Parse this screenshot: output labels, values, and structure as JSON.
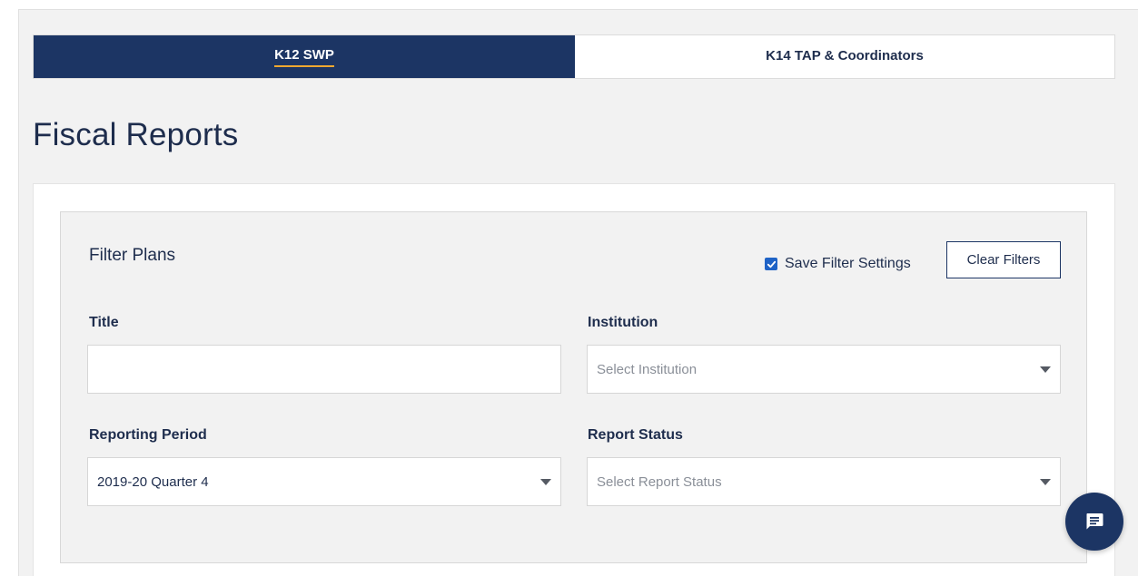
{
  "tabs": [
    {
      "label": "K12 SWP",
      "active": true
    },
    {
      "label": "K14 TAP & Coordinators",
      "active": false
    }
  ],
  "page_title": "Fiscal Reports",
  "filters": {
    "title": "Filter Plans",
    "save_settings_label": "Save Filter Settings",
    "save_settings_checked": true,
    "clear_button": "Clear Filters",
    "fields": {
      "title": {
        "label": "Title",
        "value": ""
      },
      "institution": {
        "label": "Institution",
        "placeholder": "Select Institution"
      },
      "reporting_period": {
        "label": "Reporting Period",
        "value": "2019-20 Quarter 4"
      },
      "report_status": {
        "label": "Report Status",
        "placeholder": "Select Report Status"
      }
    }
  },
  "icons": {
    "checkbox": "check-icon",
    "dropdown": "caret-down-icon",
    "chat": "chat-icon"
  },
  "colors": {
    "primary": "#1c3564",
    "accent": "#f0a830",
    "checkbox": "#1f63c6"
  }
}
